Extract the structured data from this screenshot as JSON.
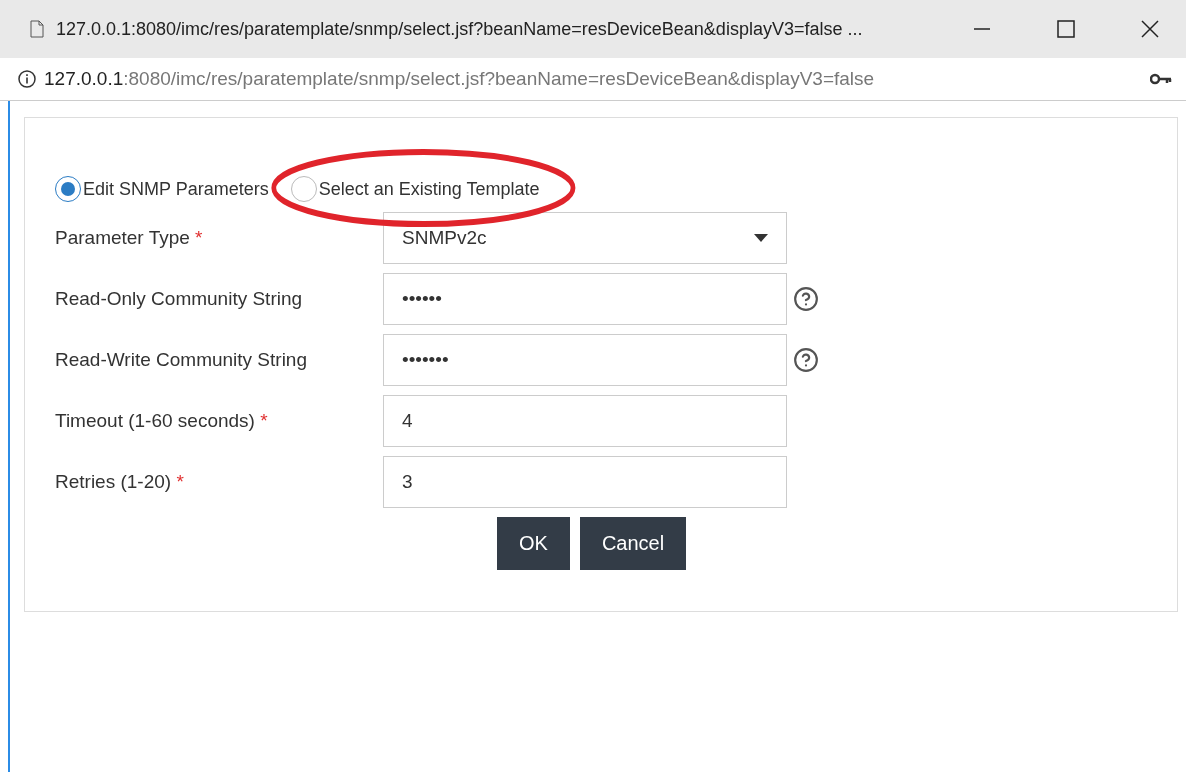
{
  "window": {
    "title": "127.0.0.1:8080/imc/res/paratemplate/snmp/select.jsf?beanName=resDeviceBean&displayV3=false ..."
  },
  "address_bar": {
    "host": "127.0.0.1",
    "path": ":8080/imc/res/paratemplate/snmp/select.jsf?beanName=resDeviceBean&displayV3=false"
  },
  "mode_options": [
    {
      "label": "Edit SNMP Parameters",
      "selected": true,
      "circled": false
    },
    {
      "label": "Select an Existing Template",
      "selected": false,
      "circled": true
    }
  ],
  "fields": [
    {
      "kind": "select",
      "label": "Parameter Type",
      "required_mark": "*",
      "value": "SNMPv2c",
      "help": false
    },
    {
      "kind": "text",
      "label": "Read-Only Community String",
      "value": "••••••",
      "help": true
    },
    {
      "kind": "text",
      "label": "Read-Write Community String",
      "value": "•••••••",
      "help": true
    },
    {
      "kind": "text",
      "label": "Timeout (1-60 seconds)",
      "required_mark": "*",
      "value": "4",
      "help": false
    },
    {
      "kind": "text",
      "label": "Retries (1-20)",
      "required_mark": "*",
      "value": "3",
      "help": false
    }
  ],
  "buttons": [
    "OK",
    "Cancel"
  ]
}
